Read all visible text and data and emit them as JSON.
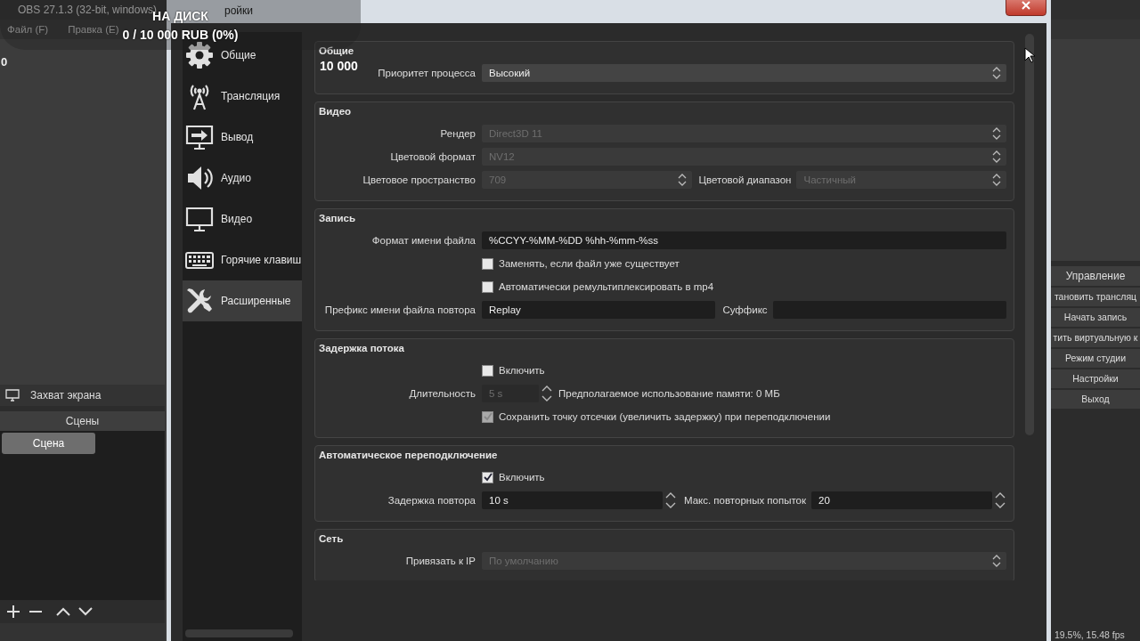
{
  "main_window": {
    "title": "OBS 27.1.3 (32-bit, windows)",
    "menu": [
      "Файл (F)",
      "Правка (E)"
    ],
    "preview_value": "0",
    "sources": [
      {
        "label": "Захват экрана"
      }
    ],
    "scenes": {
      "header": "Сцены",
      "items": [
        {
          "label": "Сцена",
          "selected": true
        }
      ]
    },
    "controls": {
      "header": "Управление",
      "buttons": [
        "тановить трансляц",
        "Начать запись",
        "тить виртуальную к",
        "Режим студии",
        "Настройки",
        "Выход"
      ]
    },
    "status": "19.5%, 15.48 fps"
  },
  "dialog": {
    "title": "ройки",
    "sidebar": [
      {
        "label": "Общие",
        "selected": false
      },
      {
        "label": "Трансляция",
        "selected": false
      },
      {
        "label": "Вывод",
        "selected": false
      },
      {
        "label": "Аудио",
        "selected": false
      },
      {
        "label": "Видео",
        "selected": false
      },
      {
        "label": "Горячие клавиш",
        "selected": false
      },
      {
        "label": "Расширенные",
        "selected": true
      }
    ],
    "groups": [
      {
        "title": "Общие",
        "rows": [
          {
            "label": "Приоритет процесса",
            "fields": [
              {
                "kind": "select",
                "value": "Высокий",
                "disabled": false
              }
            ]
          }
        ]
      },
      {
        "title": "Видео",
        "rows": [
          {
            "label": "Рендер",
            "fields": [
              {
                "kind": "select",
                "value": "Direct3D 11",
                "disabled": true
              }
            ]
          },
          {
            "label": "Цветовой формат",
            "fields": [
              {
                "kind": "select",
                "value": "NV12",
                "disabled": true
              }
            ]
          },
          {
            "label": "Цветовое пространство",
            "fields": [
              {
                "kind": "select",
                "value": "709",
                "disabled": true
              },
              {
                "kind": "select",
                "label": "Цветовой диапазон",
                "value": "Частичный",
                "disabled": true
              }
            ]
          }
        ]
      },
      {
        "title": "Запись",
        "rows": [
          {
            "label": "Формат имени файла",
            "fields": [
              {
                "kind": "text",
                "value": "%CCYY-%MM-%DD %hh-%mm-%ss"
              }
            ]
          },
          {
            "fields": [
              {
                "kind": "checkbox",
                "text": "Заменять, если файл уже существует",
                "checked": false,
                "disabled": false
              }
            ]
          },
          {
            "fields": [
              {
                "kind": "checkbox",
                "text": "Автоматически ремультиплексировать в mp4",
                "checked": false,
                "disabled": false
              }
            ]
          },
          {
            "label": "Префикс имени файла повтора",
            "fields": [
              {
                "kind": "text",
                "value": "Replay"
              },
              {
                "kind": "text",
                "label": "Суффикс"
              }
            ]
          }
        ]
      },
      {
        "title": "Задержка потока",
        "rows": [
          {
            "fields": [
              {
                "kind": "checkbox",
                "text": "Включить",
                "checked": false,
                "disabled": false
              }
            ]
          },
          {
            "label": "Длительность",
            "fields": [
              {
                "kind": "spin",
                "value": "5 s",
                "disabled": true
              },
              {
                "kind": "note",
                "text": "Предполагаемое использование памяти: 0 МБ"
              }
            ]
          },
          {
            "fields": [
              {
                "kind": "checkbox",
                "text": "Сохранить точку отсечки (увеличить задержку) при переподключении",
                "checked": true,
                "disabled": true
              }
            ]
          }
        ]
      },
      {
        "title": "Автоматическое переподключение",
        "rows": [
          {
            "fields": [
              {
                "kind": "checkbox",
                "text": "Включить",
                "checked": true,
                "disabled": false
              }
            ]
          },
          {
            "label": "Задержка повтора",
            "fields": [
              {
                "kind": "spin",
                "value": "10 s",
                "disabled": false
              },
              {
                "kind": "spin",
                "label": "Макс. повторных попыток",
                "value": "20",
                "disabled": false
              }
            ]
          }
        ]
      },
      {
        "title": "Сеть",
        "rows": [
          {
            "label": "Привязать к IP",
            "fields": [
              {
                "kind": "select",
                "value": "По умолчанию",
                "disabled": true
              }
            ]
          }
        ]
      }
    ]
  },
  "overlay": {
    "title": "НА ДИСК",
    "progress": "0 / 10 000 RUB (0%)",
    "amount": "10 000"
  }
}
